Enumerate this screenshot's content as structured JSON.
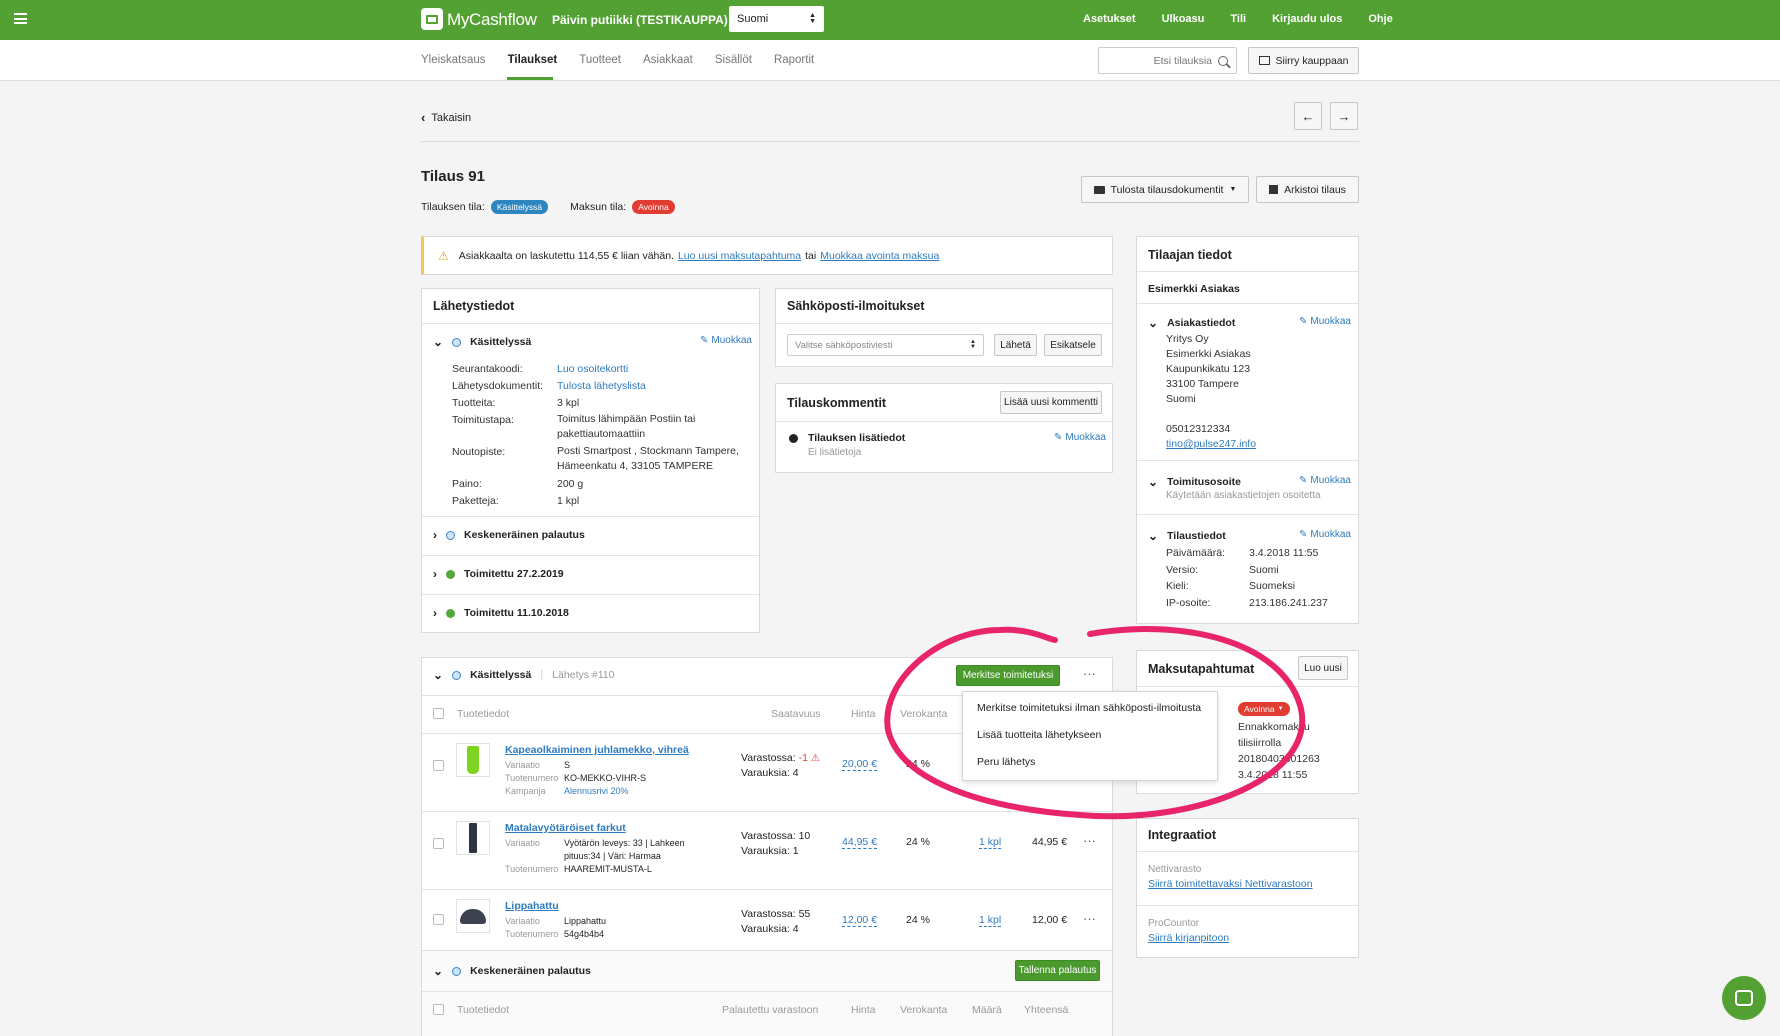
{
  "topbar": {
    "brand": "MyCashflow",
    "store": "Päivin putiikki (TESTIKAUPPA)",
    "language": "Suomi",
    "menu": [
      "Asetukset",
      "Ulkoasu",
      "Tili",
      "Kirjaudu ulos",
      "Ohje"
    ]
  },
  "subnav": {
    "tabs": [
      "Yleiskatsaus",
      "Tilaukset",
      "Tuotteet",
      "Asiakkaat",
      "Sisällöt",
      "Raportit"
    ],
    "search_placeholder": "Etsi tilauksia",
    "goto_store": "Siirry kauppaan"
  },
  "back": "Takaisin",
  "order": {
    "title": "Tilaus 91",
    "status_label": "Tilauksen tila:",
    "status": "Käsittelyssä",
    "payment_label": "Maksun tila:",
    "payment": "Avoinna",
    "print_button": "Tulosta tilausdokumentit",
    "archive_button": "Arkistoi tilaus"
  },
  "alert": {
    "text": "Asiakkaalta on laskutettu 114,55 € liian vähän.",
    "link1": "Luo uusi maksutapahtuma",
    "mid": "tai",
    "link2": "Muokkaa avointa maksua"
  },
  "shipping": {
    "title": "Lähetystiedot",
    "status": "Käsittelyssä",
    "edit": "Muokkaa",
    "labels": [
      "Seurantakoodi:",
      "Lähetysdokumentit:",
      "Tuotteita:",
      "Toimitustapa:",
      "Noutopiste:",
      "Paino:",
      "Paketteja:"
    ],
    "tracking": "Luo osoitekortti",
    "documents": "Tulosta lähetyslista",
    "items": "3 kpl",
    "method_1": "Toimitus lähimpään Postiin tai",
    "method_2": "pakettiautomaattiin",
    "pickup_1": "Posti Smartpost , Stockmann Tampere,",
    "pickup_2": "Hämeenkatu 4, 33105 TAMPERE",
    "weight": "200 g",
    "packages": "1 kpl",
    "others": [
      "Keskeneräinen palautus",
      "Toimitettu 27.2.2019",
      "Toimitettu 11.10.2018"
    ]
  },
  "email": {
    "title": "Sähköposti-ilmoitukset",
    "placeholder": "Valitse sähköpostiviesti",
    "send": "Lähetä",
    "preview": "Esikatsele"
  },
  "comments": {
    "title": "Tilauskommentit",
    "add": "Lisää uusi kommentti",
    "extra_title": "Tilauksen lisätiedot",
    "extra_empty": "Ei lisätietoja",
    "edit": "Muokkaa"
  },
  "customer": {
    "title": "Tilaajan tiedot",
    "name": "Esimerkki Asiakas",
    "edit": "Muokkaa",
    "customer_info_title": "Asiakastiedot",
    "customer_info": [
      "Yritys Oy",
      "Esimerkki Asiakas",
      "Kaupunkikatu 123",
      "33100 Tampere",
      "Suomi"
    ],
    "phone": "05012312334",
    "email": "tino@pulse247.info",
    "delivery_title": "Toimitusosoite",
    "delivery_note": "Käytetään asiakastietojen osoitetta",
    "order_info_title": "Tilaustiedot",
    "order_labels": [
      "Päivämäärä:",
      "Versio:",
      "Kieli:",
      "IP-osoite:"
    ],
    "order_values": [
      "3.4.2018 11:55",
      "Suomi",
      "Suomeksi",
      "213.186.241.237"
    ]
  },
  "payments": {
    "title": "Maksutapahtumat",
    "create": "Luo uusi",
    "status": "Avoinna",
    "lines": [
      "Ennakkomaksu",
      "tilisiirrolla",
      "20180403001263",
      "3.4.2018 11:55"
    ]
  },
  "integrations": {
    "title": "Integraatiot",
    "items": [
      {
        "name": "Nettivarasto",
        "link": "Siirrä toimitettavaksi Nettivarastoon"
      },
      {
        "name": "ProCountor",
        "link": "Siirrä kirjanpitoon"
      }
    ]
  },
  "shipment": {
    "status": "Käsittelyssä",
    "number": "Lähetys #110",
    "mark_button": "Merkitse toimitetuksi",
    "columns": [
      "Tuotetiedot",
      "Saatavuus",
      "Hinta",
      "Verokanta"
    ],
    "menu": [
      "Merkitse toimitetuksi ilman sähköposti-ilmoitusta",
      "Lisää tuotteita lähetykseen",
      "Peru lähetys"
    ],
    "products": [
      {
        "name": "Kapeaolkaiminen juhlamekko, vihreä",
        "attrs": [
          [
            "Variaatio",
            "S"
          ],
          [
            "Tuotenumero",
            "KO-MEKKO-VIHR-S"
          ],
          [
            "Kampanja",
            "Alennusrivi 20%"
          ]
        ],
        "stock_label": "Varastossa:",
        "stock": "-1",
        "reserved": "Varauksia: 4",
        "price": "20,00 €",
        "tax": "24 %",
        "qty": "",
        "total": ""
      },
      {
        "name": "Matalavyötäröiset farkut",
        "attrs": [
          [
            "Variaatio",
            "Vyötärön leveys: 33 | Lahkeen"
          ],
          [
            "",
            "pituus:34 | Väri: Harmaa"
          ],
          [
            "Tuotenumero",
            "HAAREMIT-MUSTA-L"
          ]
        ],
        "stock_label": "Varastossa:",
        "stock": "10",
        "reserved": "Varauksia: 1",
        "price": "44,95 €",
        "tax": "24 %",
        "qty": "1 kpl",
        "total": "44,95 €"
      },
      {
        "name": "Lippahattu",
        "attrs": [
          [
            "Variaatio",
            "Lippahattu"
          ],
          [
            "Tuotenumero",
            "54g4b4b4"
          ]
        ],
        "stock_label": "Varastossa:",
        "stock": "55",
        "reserved": "Varauksia: 4",
        "price": "12,00 €",
        "tax": "24 %",
        "qty": "1 kpl",
        "total": "12,00 €"
      }
    ]
  },
  "return": {
    "status": "Keskeneräinen palautus",
    "save": "Tallenna palautus",
    "columns": [
      "Tuotetiedot",
      "Palautettu varastoon",
      "Hinta",
      "Verokanta",
      "Määrä",
      "Yhteensä"
    ]
  },
  "colors": {
    "green": "#53a132",
    "blue_badge": "#2e86c1",
    "red_badge": "#e03c31",
    "annotation": "#e8246b"
  }
}
